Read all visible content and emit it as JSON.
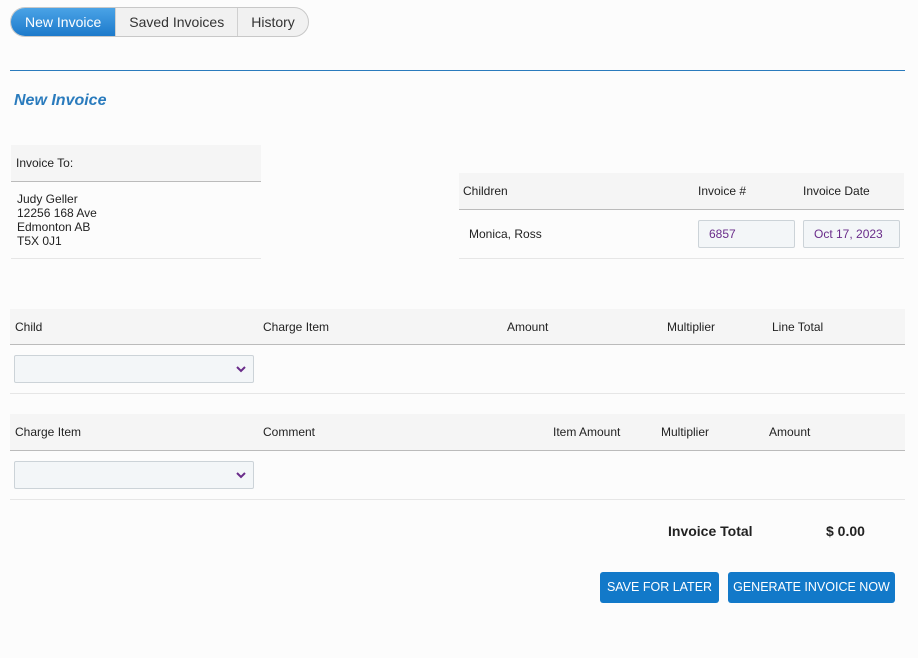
{
  "tabs": [
    {
      "label": "New Invoice",
      "active": true
    },
    {
      "label": "Saved Invoices",
      "active": false
    },
    {
      "label": "History",
      "active": false
    }
  ],
  "page_title": "New Invoice",
  "invoice_to": {
    "header": "Invoice To:",
    "address_lines": [
      "Judy Geller",
      "12256 168 Ave",
      "Edmonton AB",
      "T5X 0J1"
    ]
  },
  "summary": {
    "headers": {
      "children": "Children",
      "invoice_no": "Invoice #",
      "invoice_date": "Invoice Date"
    },
    "children_value": "Monica, Ross",
    "invoice_no_value": "6857",
    "invoice_date_value": "Oct 17, 2023"
  },
  "child_table": {
    "headers": {
      "child": "Child",
      "charge_item": "Charge Item",
      "amount": "Amount",
      "multiplier": "Multiplier",
      "line_total": "Line Total"
    },
    "child_select_value": ""
  },
  "charge_table": {
    "headers": {
      "charge_item": "Charge Item",
      "comment": "Comment",
      "item_amount": "Item Amount",
      "multiplier": "Multiplier",
      "amount": "Amount"
    },
    "charge_select_value": ""
  },
  "totals": {
    "label": "Invoice Total",
    "value": "$ 0.00"
  },
  "buttons": {
    "save": "SAVE FOR LATER",
    "generate": "GENERATE INVOICE NOW"
  },
  "colors": {
    "accent": "#2a7bbd",
    "button": "#1279c9",
    "value_text": "#6a2c8a"
  }
}
